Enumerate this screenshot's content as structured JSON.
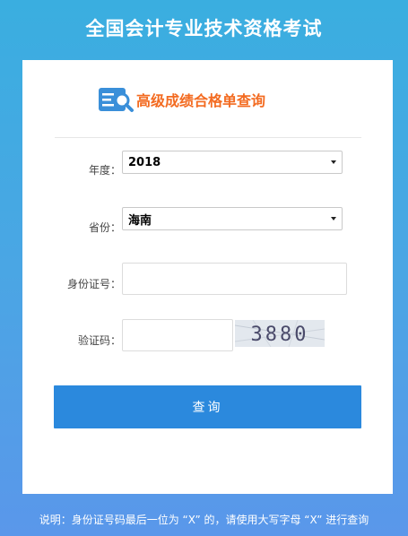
{
  "header": {
    "title": "全国会计专业技术资格考试"
  },
  "panel": {
    "heading": "高级成绩合格单查询",
    "logo_icon": "search-document-icon"
  },
  "form": {
    "year_label": "年度：",
    "year_value": "2018",
    "province_label": "省份：",
    "province_value": "海南",
    "id_label": "身份证号：",
    "id_value": "",
    "captcha_label": "验证码：",
    "captcha_value": "",
    "captcha_text": "3880",
    "submit_label": "查询"
  },
  "footer": {
    "note": "说明：身份证号码最后一位为 “X” 的，请使用大写字母 “X” 进行查询"
  },
  "colors": {
    "accent": "#2b89dd",
    "heading": "#f36b21",
    "background_top": "#3aaee0",
    "background_bottom": "#5a97ea"
  }
}
